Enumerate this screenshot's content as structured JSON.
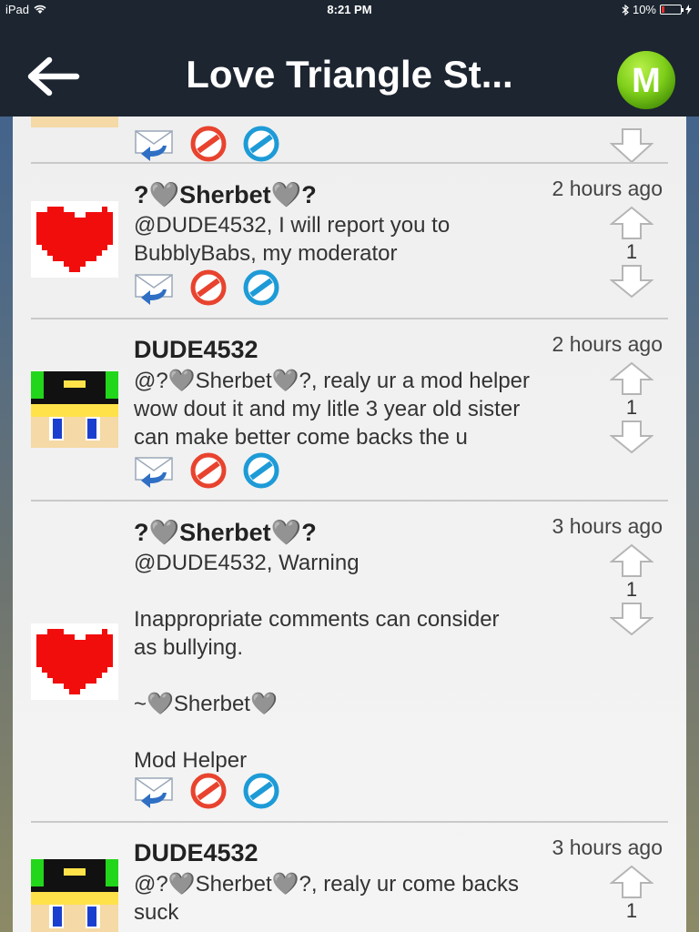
{
  "status_bar": {
    "device": "iPad",
    "time": "8:21 PM",
    "battery": "10%"
  },
  "header": {
    "title": "Love Triangle St...",
    "logo_letter": "M",
    "colors": {
      "bar": "#1c2530",
      "logo": "#7fcf1a"
    }
  },
  "comments": [
    {
      "author": "?🩶Sherbet🩶?",
      "time": "2 hours ago",
      "text": "@DUDE4532, I will report you to\nBubblyBabs, my moderator",
      "votes": "1",
      "avatar": "heart-avatar"
    },
    {
      "author": "DUDE4532",
      "time": "2 hours ago",
      "text": "@?🩶Sherbet🩶?, realy ur a mod helper\nwow dout it and my litle 3 year old sister\ncan make better come backs the u",
      "votes": "1",
      "avatar": "pixel-boy-avatar"
    },
    {
      "author": "?🩶Sherbet🩶?",
      "time": "3 hours ago",
      "text": "@DUDE4532, Warning\n\nInappropriate comments can consider\nas bullying.\n\n~🩶Sherbet🩶\n\nMod Helper",
      "votes": "1",
      "avatar": "heart-avatar"
    },
    {
      "author": "DUDE4532",
      "time": "3 hours ago",
      "text": "@?🩶Sherbet🩶?, realy ur come backs\nsuck",
      "votes": "1",
      "avatar": "pixel-boy-avatar"
    }
  ],
  "icons": {
    "reply": "reply-envelope-icon",
    "report": "report-block-icon",
    "block": "block-user-icon",
    "upvote": "upvote-arrow-icon",
    "downvote": "downvote-arrow-icon"
  }
}
